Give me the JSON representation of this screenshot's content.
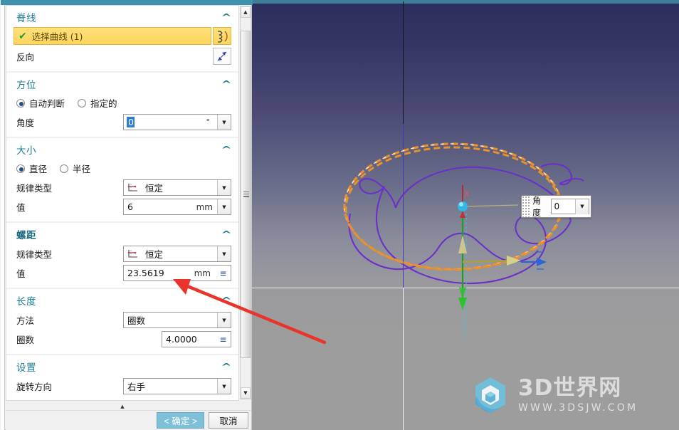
{
  "app": {
    "dialog_title": "",
    "theme_accent": "#1d7a93",
    "highlight_color": "#fcd55e",
    "primary_button_color": "#7fc0d9"
  },
  "sections": [
    {
      "id": "spine",
      "title": "脊线",
      "bold": false,
      "pick": {
        "label": "选择曲线 (1)",
        "tick": "✔",
        "icon": "curve-select-icon"
      },
      "reverse": {
        "label": "反向",
        "icon": "reverse-direction-icon"
      }
    },
    {
      "id": "orientation",
      "title": "方位",
      "bold": false,
      "radios": [
        {
          "label": "自动判断",
          "selected": true
        },
        {
          "label": "指定的",
          "selected": false
        }
      ],
      "angle": {
        "label": "角度",
        "value": "0",
        "unit": "°",
        "selected": true
      }
    },
    {
      "id": "size",
      "title": "大小",
      "bold": false,
      "radios": [
        {
          "label": "直径",
          "selected": true
        },
        {
          "label": "半径",
          "selected": false
        }
      ],
      "law_type": {
        "label": "规律类型",
        "value": "恒定",
        "icon": "law-curve-icon"
      },
      "value": {
        "label": "值",
        "value": "6",
        "unit": "mm"
      }
    },
    {
      "id": "pitch",
      "title": "螺距",
      "bold": true,
      "law_type": {
        "label": "规律类型",
        "value": "恒定",
        "icon": "law-curve-icon"
      },
      "value": {
        "label": "值",
        "value": "23.5619",
        "unit": "mm",
        "formula_icon": "≡"
      }
    },
    {
      "id": "length",
      "title": "长度",
      "bold": false,
      "method": {
        "label": "方法",
        "value": "圈数"
      },
      "turns": {
        "label": "圈数",
        "value": "4.0000",
        "formula_icon": "≡"
      }
    },
    {
      "id": "settings",
      "title": "设置",
      "bold": false,
      "rotation": {
        "label": "旋转方向",
        "value": "右手"
      }
    }
  ],
  "footer": {
    "ok_label": "< 确定 >",
    "cancel_label": "取消"
  },
  "scrollbar": {
    "up_glyph": "▲",
    "down_glyph": "▼",
    "grip_glyph": "▲"
  },
  "floating_widget": {
    "label": "角度",
    "value": "0",
    "dropdown_glyph": "▼"
  },
  "viewport": {
    "axis_label_x": "X",
    "bg_top_color": "#2c2c5e",
    "bg_bottom_color": "#9d9d9d",
    "helix_color": "#e8912f",
    "spline_color": "#6a30c8",
    "datum_color": "#f2f2f2"
  },
  "watermark": {
    "title": "3D世界网",
    "url": "WWW.3DSJW.COM"
  },
  "annotation": {
    "arrow_color": "#e8342a",
    "points_at": "pitch-value-field"
  }
}
